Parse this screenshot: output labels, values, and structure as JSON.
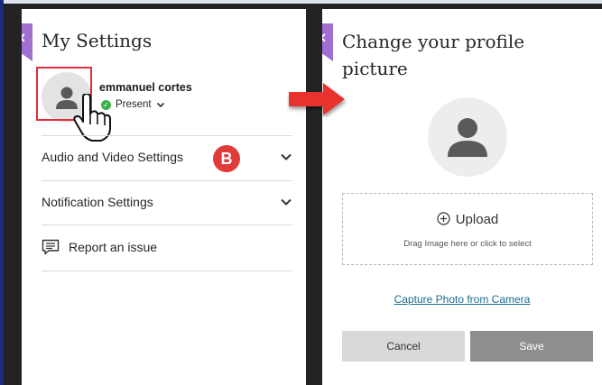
{
  "left_panel": {
    "title": "My Settings",
    "close_label": "×",
    "user": {
      "name": "emmanuel cortes",
      "status": "Present"
    },
    "menu": {
      "audio_video": "Audio and Video Settings",
      "notifications": "Notification Settings",
      "report": "Report an issue"
    }
  },
  "annotation": {
    "badge": "B"
  },
  "right_panel": {
    "title": "Change your profile picture",
    "close_label": "×",
    "upload": {
      "label": "Upload",
      "hint": "Drag Image here or click to select"
    },
    "capture_link": "Capture Photo from Camera",
    "buttons": {
      "cancel": "Cancel",
      "save": "Save"
    }
  },
  "colors": {
    "accent": "#a06fd1",
    "annotation_red": "#e02e3a",
    "present_green": "#3bb34a",
    "link": "#1d6b8f"
  }
}
